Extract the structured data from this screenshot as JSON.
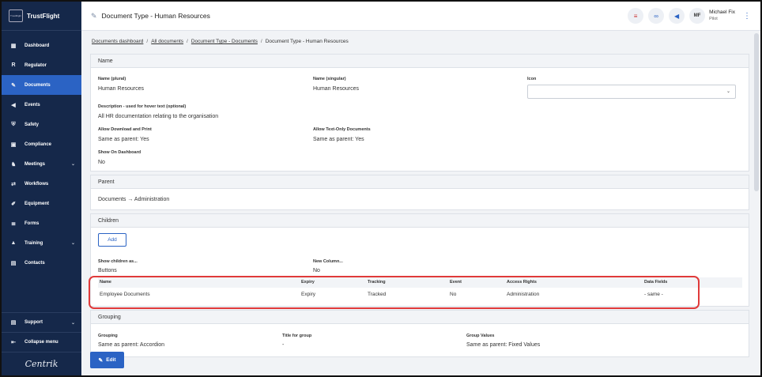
{
  "brand": {
    "name": "TrustFlight",
    "logo_small": "TrustFlight",
    "footer": "Centrik"
  },
  "sidebar": {
    "items": [
      {
        "label": "Dashboard",
        "icon": "dashboard-icon",
        "glyph": "▦"
      },
      {
        "label": "Regulator",
        "icon": "regulator-icon",
        "glyph": "R"
      },
      {
        "label": "Documents",
        "icon": "paperclip-icon",
        "glyph": "✎",
        "active": true
      },
      {
        "label": "Events",
        "icon": "megaphone-icon",
        "glyph": "◀"
      },
      {
        "label": "Safety",
        "icon": "shield-icon",
        "glyph": "⛨"
      },
      {
        "label": "Compliance",
        "icon": "clipboard-icon",
        "glyph": "▣"
      },
      {
        "label": "Meetings",
        "icon": "meetings-icon",
        "glyph": "♞",
        "caret": true
      },
      {
        "label": "Workflows",
        "icon": "workflow-icon",
        "glyph": "⇄"
      },
      {
        "label": "Equipment",
        "icon": "wrench-icon",
        "glyph": "✐"
      },
      {
        "label": "Forms",
        "icon": "forms-icon",
        "glyph": "≣"
      },
      {
        "label": "Training",
        "icon": "graduation-cap-icon",
        "glyph": "▲",
        "caret": true
      },
      {
        "label": "Contacts",
        "icon": "contacts-icon",
        "glyph": "▤"
      }
    ],
    "support": "Support",
    "collapse": "Collapse menu"
  },
  "header": {
    "title": "Document Type - Human Resources",
    "user_initials": "MF",
    "user_name": "Michael Fix",
    "user_role": "Pilot"
  },
  "breadcrumbs": [
    "Documents dashboard",
    "All documents",
    "Document Type - Documents",
    "Document Type - Human Resources"
  ],
  "name_card": {
    "heading": "Name",
    "plural_label": "Name (plural)",
    "plural_value": "Human Resources",
    "singular_label": "Name (singular)",
    "singular_value": "Human Resources",
    "icon_label": "Icon",
    "desc_label": "Description - used for hover text (optional)",
    "desc_value": "All HR documentation relating to the organisation",
    "download_label": "Allow Download and Print",
    "download_value": "Same as parent: Yes",
    "textonly_label": "Allow Text-Only Documents",
    "textonly_value": "Same as parent: Yes",
    "dashboard_label": "Show On Dashboard",
    "dashboard_value": "No"
  },
  "parent_card": {
    "heading": "Parent",
    "value": "Documents → Administration"
  },
  "children_card": {
    "heading": "Children",
    "add_label": "Add",
    "show_label": "Show children as...",
    "show_value": "Buttons",
    "newcol_label": "New Column...",
    "newcol_value": "No",
    "columns": [
      "Name",
      "Expiry",
      "Tracking",
      "Event",
      "Access Rights",
      "Data Fields"
    ],
    "rows": [
      [
        "Employee Documents",
        "Expiry",
        "Tracked",
        "No",
        "Administration",
        "- same -"
      ]
    ]
  },
  "grouping_card": {
    "heading": "Grouping",
    "grouping_label": "Grouping",
    "grouping_value": "Same as parent: Accordion",
    "title_label": "Title for group",
    "title_value": "-",
    "values_label": "Group Values",
    "values_value": "Same as parent: Fixed Values"
  },
  "edit_label": "Edit",
  "colors": {
    "sidebar": "#15284a",
    "accent": "#2b63c4",
    "highlight": "#e03a3a"
  }
}
